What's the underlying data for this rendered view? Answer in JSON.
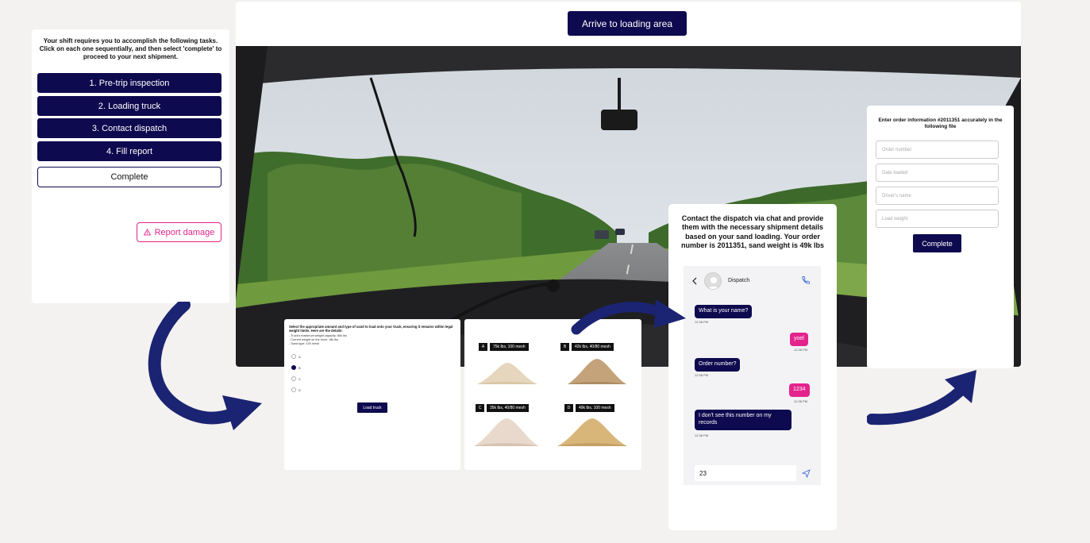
{
  "task_panel": {
    "intro": "Your shift requires you to accomplish the following tasks. Click on each one sequentially, and then select 'complete' to proceed to your next shipment.",
    "tasks": [
      "1. Pre-trip inspection",
      "2. Loading truck",
      "3. Contact dispatch",
      "4. Fill report"
    ],
    "complete_label": "Complete",
    "report_label": "Report damage",
    "report_icon": "warning-icon"
  },
  "main": {
    "arrive_label": "Arrive to loading area"
  },
  "sand": {
    "instructions": "Select the appropriate amount and type of sand to load onto your truck, ensuring it remains within legal weight limits. Here are the details:",
    "details": [
      "- Truck's maximum weight capacity: 80k lbs",
      "- Current weight on the truck: 18k lbs",
      "- Sand type: 100 mesh"
    ],
    "radio_options": [
      "A",
      "B",
      "C",
      "D"
    ],
    "selected": "B",
    "load_label": "Load truck",
    "options": [
      {
        "letter": "A",
        "desc": "75k lbs, 100 mesh",
        "color": "#e6d6bd"
      },
      {
        "letter": "B",
        "desc": "42k lbs, 40/80 mesh",
        "color": "#c4a27a"
      },
      {
        "letter": "C",
        "desc": "35k lbs, 40/80 mesh",
        "color": "#e9d9cc"
      },
      {
        "letter": "D",
        "desc": "49k lbs, 100 mesh",
        "color": "#d8b67a"
      }
    ]
  },
  "chat": {
    "title": "Contact the dispatch via chat and provide them with the necessary shipment details based on your sand loading. Your order number is 2011351, sand weight is 49k lbs",
    "contact": "Dispatch",
    "messages": [
      {
        "dir": "in",
        "text": "What is your name?",
        "time": "12:38 PM"
      },
      {
        "dir": "out",
        "text": "yoel",
        "time": "12:38 PM"
      },
      {
        "dir": "in",
        "text": "Order number?",
        "time": "12:38 PM"
      },
      {
        "dir": "out",
        "text": "1234",
        "time": "12:38 PM"
      },
      {
        "dir": "in",
        "text": "I don't see this number on my records",
        "time": "12:38 PM"
      }
    ],
    "input_value": "23"
  },
  "order": {
    "title": "Enter order information #2011351 accurately in the following file",
    "fields": [
      "Order number",
      "Date loaded",
      "Driver's name",
      "Load weight"
    ],
    "complete_label": "Complete"
  },
  "colors": {
    "navy": "#0e0a4f",
    "pink": "#e3248c",
    "background": "#f4f2f0"
  }
}
